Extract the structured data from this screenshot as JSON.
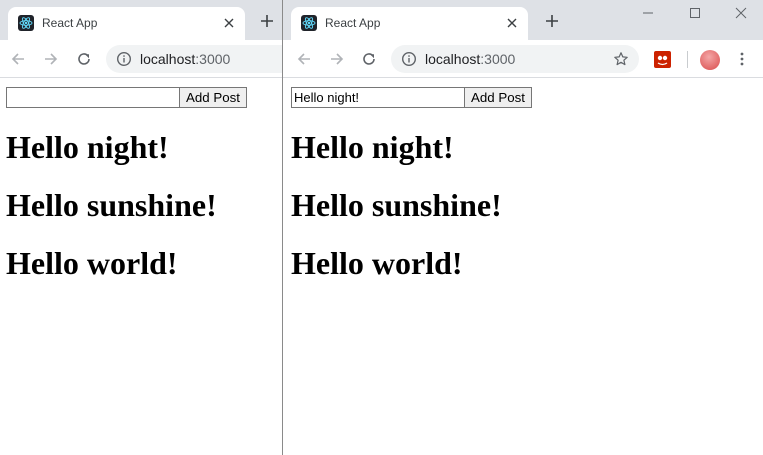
{
  "windows": [
    {
      "tab": {
        "title": "React App"
      },
      "address": {
        "host": "localhost",
        "port": ":3000"
      },
      "form": {
        "input_value": "",
        "button_label": "Add Post"
      },
      "posts": [
        "Hello night!",
        "Hello sunshine!",
        "Hello world!"
      ]
    },
    {
      "tab": {
        "title": "React App"
      },
      "address": {
        "host": "localhost",
        "port": ":3000"
      },
      "form": {
        "input_value": "Hello night!",
        "button_label": "Add Post"
      },
      "posts": [
        "Hello night!",
        "Hello sunshine!",
        "Hello world!"
      ]
    }
  ],
  "colors": {
    "tabstrip": "#dee1e6",
    "omnibox": "#f1f3f4",
    "react_logo": "#61dafb",
    "extension": "#cc2200",
    "profile": "#d94b4b"
  },
  "icons": [
    "react-favicon-icon",
    "close-icon",
    "plus-icon",
    "back-arrow-icon",
    "forward-arrow-icon",
    "reload-icon",
    "info-icon",
    "star-icon",
    "extension-icon",
    "avatar",
    "more-vert-icon",
    "minimize-icon",
    "maximize-icon",
    "close-window-icon"
  ]
}
